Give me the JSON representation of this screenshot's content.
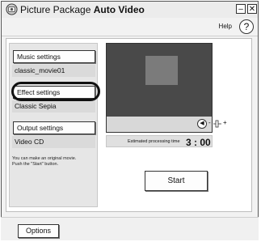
{
  "window": {
    "title_prefix": "Picture Package ",
    "title_bold": "Auto Video",
    "minimize_label": "–",
    "close_label": "✕"
  },
  "help": {
    "label": "Help",
    "button_label": "?"
  },
  "settings": {
    "music": {
      "button_label": "Music settings",
      "value": "classic_movie01"
    },
    "effect": {
      "button_label": "Effect settings",
      "value": "Classic Sepia"
    },
    "output": {
      "button_label": "Output settings",
      "value": "Video CD"
    }
  },
  "description_lines": [
    "You can make an original movie.",
    "Push the \"Start\" button."
  ],
  "estimate": {
    "label": "Estimated processing time",
    "time": "3 : 00"
  },
  "volume": {
    "minus": "-",
    "plus": "+"
  },
  "start_button": "Start",
  "options_button": "Options",
  "icons": [
    "app-icon",
    "minimize-icon",
    "close-icon",
    "help-icon",
    "speaker-icon",
    "volume-slider-icon"
  ]
}
